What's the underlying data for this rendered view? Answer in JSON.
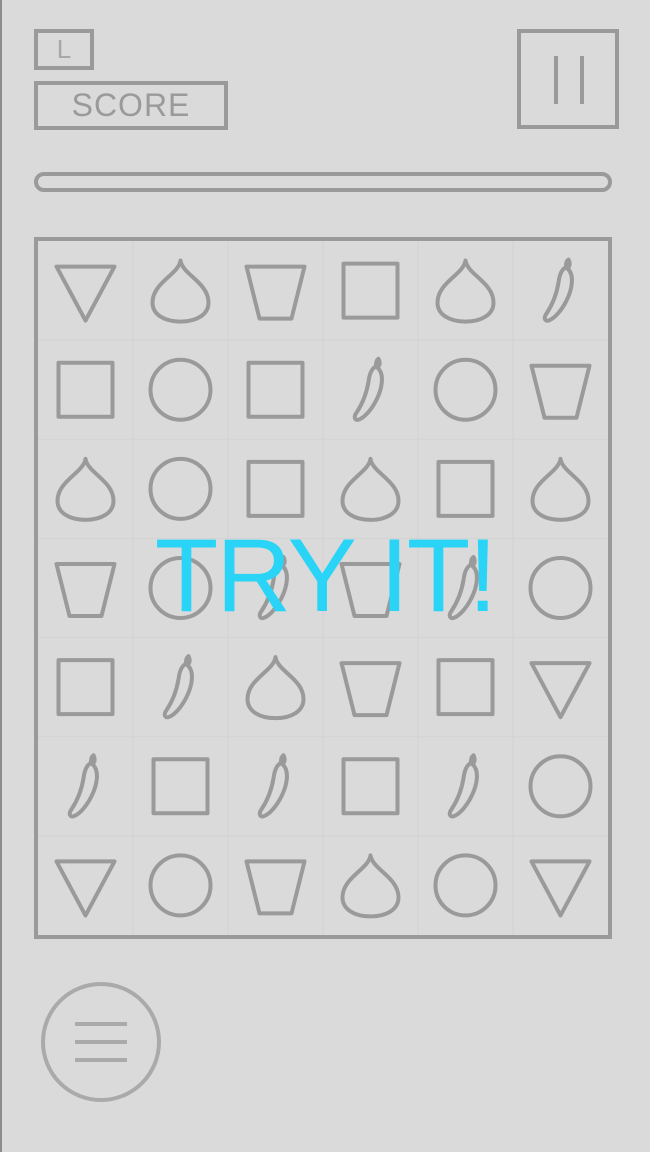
{
  "header": {
    "level_label": "L",
    "score_label": "SCORE"
  },
  "pause_button": {
    "icon": "pause-icon"
  },
  "progress": {
    "fraction": 0
  },
  "overlay": {
    "text": "TRY IT!",
    "color": "#2ad4f7"
  },
  "board": {
    "rows": 7,
    "cols": 6,
    "shape_color": "#9a9a9a",
    "cells": [
      [
        "triangle",
        "drop",
        "trapezoid",
        "square",
        "drop",
        "chili"
      ],
      [
        "square",
        "circle",
        "square",
        "chili",
        "circle",
        "trapezoid"
      ],
      [
        "drop",
        "circle",
        "square",
        "drop",
        "square",
        "drop"
      ],
      [
        "trapezoid",
        "circle",
        "chili",
        "trapezoid",
        "chili",
        "circle"
      ],
      [
        "square",
        "chili",
        "drop",
        "trapezoid",
        "square",
        "triangle"
      ],
      [
        "chili",
        "square",
        "chili",
        "square",
        "chili",
        "circle"
      ],
      [
        "triangle",
        "circle",
        "trapezoid",
        "drop",
        "circle",
        "triangle"
      ]
    ]
  },
  "menu_button": {
    "icon": "hamburger-menu-icon"
  }
}
